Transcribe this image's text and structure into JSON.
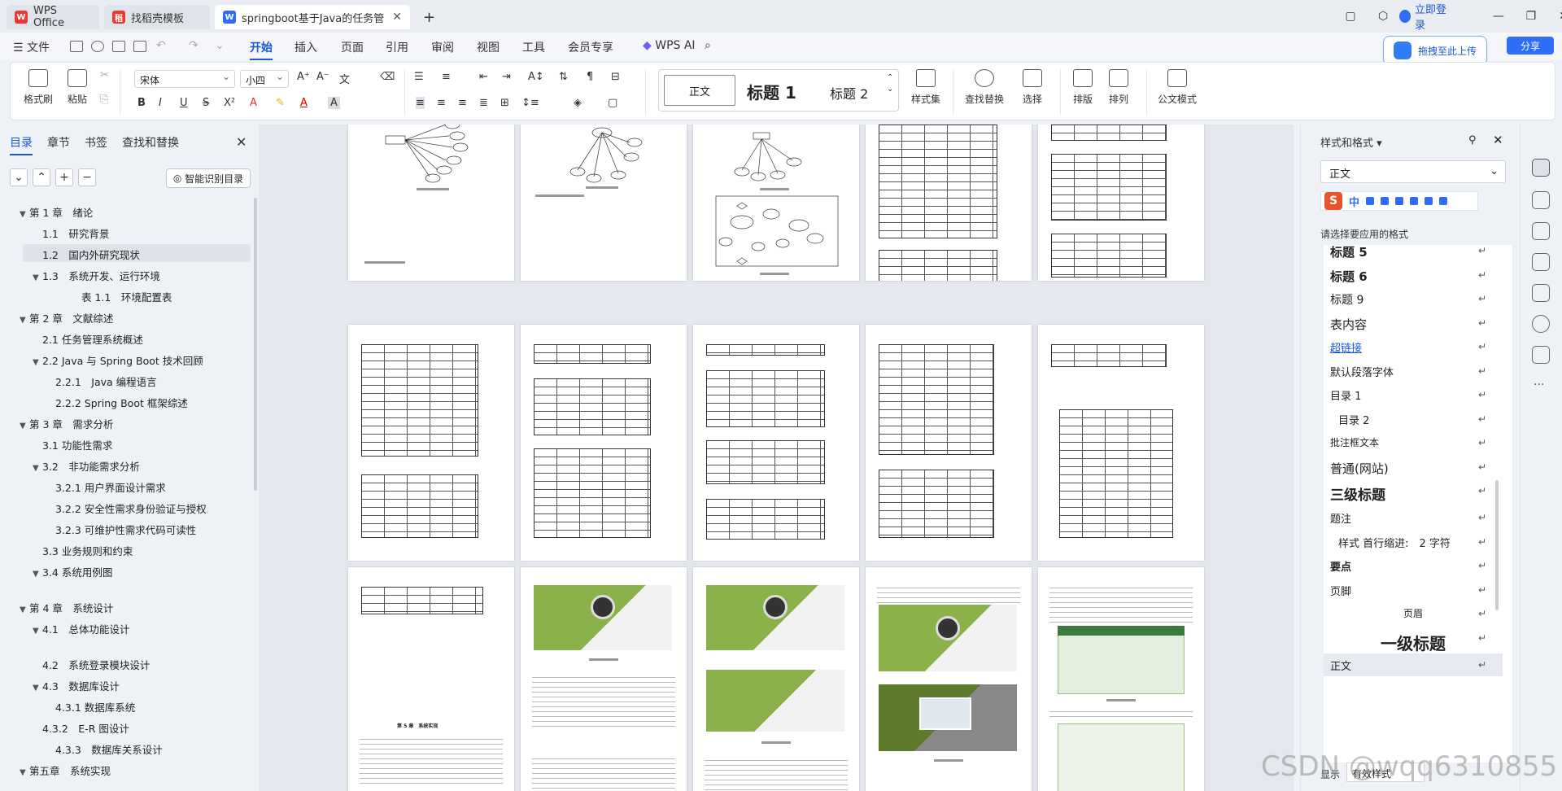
{
  "tabs": [
    {
      "label": "WPS Office",
      "icon_color": "#e63b2e"
    },
    {
      "label": "找稻壳模板",
      "icon_color": "#e63b2e"
    },
    {
      "label": "springboot基于Java的任务管",
      "icon_color": "#2f6df6"
    }
  ],
  "titlebar": {
    "login": "立即登录",
    "new_tab": "+"
  },
  "menu": {
    "file": "文件",
    "items": [
      "开始",
      "插入",
      "页面",
      "引用",
      "审阅",
      "视图",
      "工具",
      "会员专享"
    ],
    "active": "开始",
    "ai": "WPS AI",
    "upload": "拖拽至此上传",
    "share": "分享"
  },
  "ribbon": {
    "format_painter": "格式刷",
    "paste": "粘贴",
    "font": "宋体",
    "size": "小四",
    "styles": {
      "normal": "正文",
      "h1": "标题 1",
      "h2": "标题 2"
    },
    "style_set": "样式集",
    "find_replace": "查找替换",
    "select": "选择",
    "layout": "排版",
    "arrange": "排列",
    "doc_mode": "公文模式",
    "bold": "B",
    "italic": "I",
    "underline": "U"
  },
  "leftpanel": {
    "tabs": [
      "目录",
      "章节",
      "书签",
      "查找和替换"
    ],
    "smart_btn": "智能识别目录",
    "toc": [
      {
        "text": "第 1 章　绪论",
        "level": 1,
        "arrow": "▼"
      },
      {
        "text": "1.1　研究背景",
        "level": 2,
        "arrow": ""
      },
      {
        "text": "1.2　国内外研究现状",
        "level": 2,
        "arrow": "",
        "selected": true
      },
      {
        "text": "1.3　系统开发、运行环境",
        "level": 2,
        "arrow": "▼"
      },
      {
        "text": "表 1.1　环境配置表",
        "level": 4,
        "arrow": ""
      },
      {
        "text": "第 2 章　文献综述",
        "level": 1,
        "arrow": "▼"
      },
      {
        "text": "2.1 任务管理系统概述",
        "level": 2,
        "arrow": ""
      },
      {
        "text": "2.2 Java 与 Spring Boot 技术回顾",
        "level": 2,
        "arrow": "▼"
      },
      {
        "text": "2.2.1　Java 编程语言",
        "level": 3,
        "arrow": ""
      },
      {
        "text": "2.2.2 Spring Boot 框架综述",
        "level": 3,
        "arrow": ""
      },
      {
        "text": "第 3 章　需求分析",
        "level": 1,
        "arrow": "▼"
      },
      {
        "text": "3.1 功能性需求",
        "level": 2,
        "arrow": ""
      },
      {
        "text": "3.2　非功能需求分析",
        "level": 2,
        "arrow": "▼"
      },
      {
        "text": "3.2.1 用户界面设计需求",
        "level": 3,
        "arrow": ""
      },
      {
        "text": "3.2.2 安全性需求身份验证与授权",
        "level": 3,
        "arrow": ""
      },
      {
        "text": "3.2.3 可维护性需求代码可读性",
        "level": 3,
        "arrow": ""
      },
      {
        "text": "3.3 业务规则和约束",
        "level": 2,
        "arrow": ""
      },
      {
        "text": "3.4 系统用例图",
        "level": 2,
        "arrow": "▼"
      },
      {
        "text": "第 4 章　系统设计",
        "level": 1,
        "arrow": "▼"
      },
      {
        "text": "4.1　总体功能设计",
        "level": 2,
        "arrow": "▼"
      },
      {
        "text": "4.2　系统登录模块设计",
        "level": 2,
        "arrow": ""
      },
      {
        "text": "4.3　数据库设计",
        "level": 2,
        "arrow": "▼"
      },
      {
        "text": "4.3.1 数据库系统",
        "level": 3,
        "arrow": ""
      },
      {
        "text": "4.3.2　E-R 图设计",
        "level": 2,
        "arrow": ""
      },
      {
        "text": "4.3.3　数据库关系设计",
        "level": 3,
        "arrow": ""
      },
      {
        "text": "第五章　系统实现",
        "level": 1,
        "arrow": "▼"
      }
    ]
  },
  "rightpanel": {
    "title": "样式和格式",
    "current": "正文",
    "hint": "请选择要应用的格式",
    "styles": [
      {
        "name": "标题 5",
        "size": 15,
        "bold": true
      },
      {
        "name": "标题 6",
        "size": 15,
        "bold": true
      },
      {
        "name": "标题 9",
        "size": 14,
        "bold": false
      },
      {
        "name": "表内容",
        "size": 15,
        "bold": false
      },
      {
        "name": "超链接",
        "size": 13,
        "bold": false,
        "link": true
      },
      {
        "name": "默认段落字体",
        "size": 13,
        "bold": false
      },
      {
        "name": "目录 1",
        "size": 13,
        "bold": false
      },
      {
        "name": "目录 2",
        "size": 13,
        "bold": false,
        "indent": true
      },
      {
        "name": "批注框文本",
        "size": 12,
        "bold": false
      },
      {
        "name": "普通(网站)",
        "size": 15,
        "bold": false
      },
      {
        "name": "三级标题",
        "size": 17,
        "bold": true
      },
      {
        "name": "题注",
        "size": 13,
        "bold": false
      },
      {
        "name": "样式 首行缩进:　2 字符",
        "size": 13,
        "bold": false,
        "indent": true
      },
      {
        "name": "要点",
        "size": 13,
        "bold": true
      },
      {
        "name": "页脚",
        "size": 13,
        "bold": false
      },
      {
        "name": "页眉",
        "size": 12,
        "bold": false,
        "center": true
      },
      {
        "name": "一级标题",
        "size": 20,
        "bold": true,
        "center": true
      },
      {
        "name": "正文",
        "size": 13,
        "bold": false,
        "selected": true
      }
    ],
    "show_label": "显示",
    "show_value": "有效样式"
  },
  "document": {
    "page4_heading": "第 5 章　系统实现"
  },
  "watermark": "CSDN @wqq6310855"
}
